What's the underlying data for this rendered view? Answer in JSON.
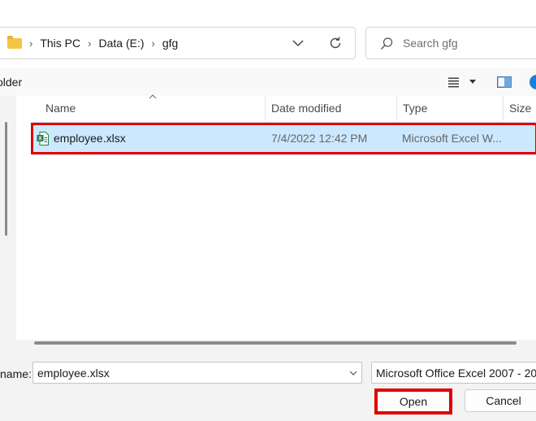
{
  "address": {
    "breadcrumbs": [
      "This PC",
      "Data (E:)",
      "gfg"
    ]
  },
  "search": {
    "placeholder": "Search gfg"
  },
  "toolbar": {
    "new_folder_label": "older"
  },
  "file_list": {
    "columns": [
      "Name",
      "Date modified",
      "Type",
      "Size"
    ],
    "rows": [
      {
        "name": "employee.xlsx",
        "date_modified": "7/4/2022 12:42 PM",
        "type": "Microsoft Excel W...",
        "selected": true
      }
    ]
  },
  "bottom": {
    "file_name_label": "name:",
    "file_name_value": "employee.xlsx",
    "file_type_value": "Microsoft Office Excel 2007 - 20",
    "open_label": "Open",
    "cancel_label": "Cancel"
  },
  "colors": {
    "selection": "#cce8ff",
    "highlight_border": "#e00000",
    "folder": "#f3c546",
    "excel_green": "#1d7a45",
    "help_blue": "#1a7fd8"
  },
  "icons": [
    "folder-icon",
    "chevron-right-icon",
    "chevron-down-icon",
    "refresh-icon",
    "search-icon",
    "view-list-icon",
    "preview-pane-icon",
    "help-icon",
    "excel-file-icon",
    "sort-ascending-icon"
  ]
}
